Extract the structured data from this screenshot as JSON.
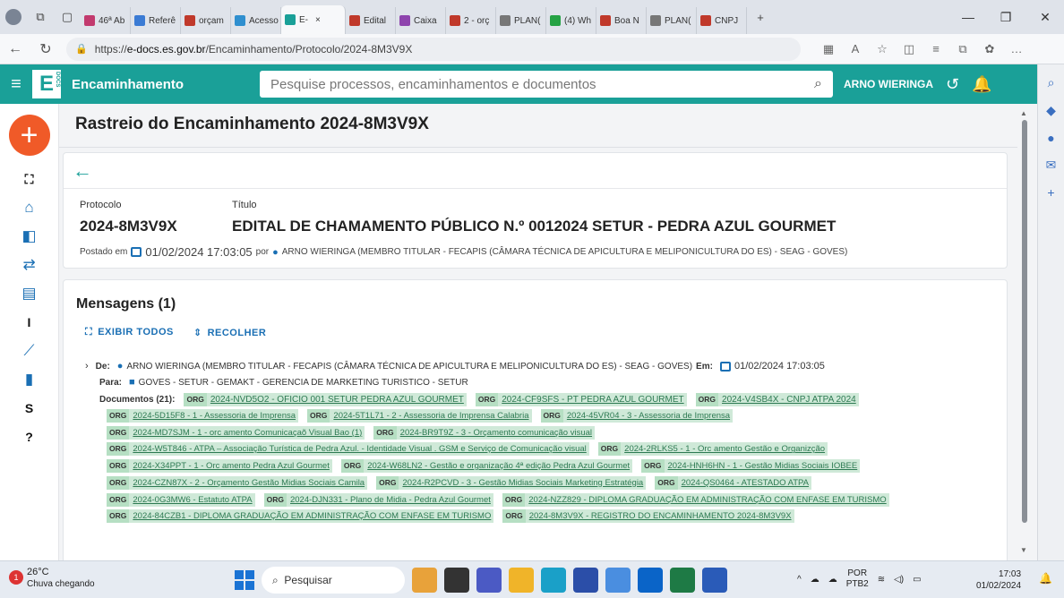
{
  "browser": {
    "tabs": [
      {
        "label": "46ª Ab",
        "color": "#c23a6e"
      },
      {
        "label": "Referê",
        "color": "#3b7bd4"
      },
      {
        "label": "orçam",
        "color": "#c0392b"
      },
      {
        "label": "Acesso",
        "color": "#2f8fcf"
      },
      {
        "label": "E-",
        "color": "#1aa098",
        "active": true
      },
      {
        "label": "Edital",
        "color": "#c0392b"
      },
      {
        "label": "Caixa",
        "color": "#8e44ad"
      },
      {
        "label": "2 - orç",
        "color": "#c0392b"
      },
      {
        "label": "PLAN(",
        "color": "#777777"
      },
      {
        "label": "(4) Wh",
        "color": "#25a244"
      },
      {
        "label": "Boa N",
        "color": "#c0392b"
      },
      {
        "label": "PLAN(",
        "color": "#777777"
      },
      {
        "label": "CNPJ",
        "color": "#c0392b"
      }
    ],
    "tab_close": "×",
    "new_tab": "+",
    "url_prefix": "https://",
    "url_host": "e-docs.es.gov.br",
    "url_path": "/Encaminhamento/Protocolo/2024-8M3V9X"
  },
  "header": {
    "app_title": "Encaminhamento",
    "logo_letter": "E",
    "logo_sub": "DOCS",
    "search_placeholder": "Pesquise processos, encaminhamentos e documentos",
    "user_name": "ARNO WIERINGA"
  },
  "page": {
    "title": "Rastreio do Encaminhamento 2024-8M3V9X",
    "protocolo_label": "Protocolo",
    "protocolo": "2024-8M3V9X",
    "titulo_label": "Título",
    "titulo": "EDITAL DE CHAMAMENTO PÚBLICO N.º 0012024 SETUR - PEDRA AZUL GOURMET",
    "posted_prefix": "Postado em",
    "posted_date": "01/02/2024 17:03:05",
    "posted_by_prefix": "por",
    "posted_by": "ARNO WIERINGA (MEMBRO TITULAR - FECAPIS (CÂMARA TÉCNICA DE APICULTURA E MELIPONICULTURA DO ES) - SEAG - GOVES)"
  },
  "messages": {
    "title": "Mensagens (1)",
    "show_all": "EXIBIR TODOS",
    "collapse": "RECOLHER",
    "de_label": "De:",
    "de_value": "ARNO WIERINGA (MEMBRO TITULAR - FECAPIS (CÂMARA TÉCNICA DE APICULTURA E MELIPONICULTURA DO ES) - SEAG - GOVES)",
    "em_label": "Em:",
    "em_value": "01/02/2024 17:03:05",
    "para_label": "Para:",
    "para_value": "GOVES - SETUR - GEMAKT - GERENCIA DE MARKETING TURISTICO - SETUR",
    "docs_label": "Documentos (21):",
    "org_tag": "ORG",
    "documents": [
      [
        "2024-NVD5O2 - OFICIO 001 SETUR PEDRA AZUL GOURMET",
        "2024-CF9SFS - PT PEDRA AZUL GOURMET",
        "2024-V4SB4X - CNPJ ATPA 2024"
      ],
      [
        "2024-5D15F8 - 1 - Assessoria de Imprensa",
        "2024-5T1L71 - 2 - Assessoria de Imprensa Calabria",
        "2024-45VR04 - 3 - Assessoria de Imprensa"
      ],
      [
        "2024-MD7SJM - 1 - orc amento Comunicaçaõ Visual Bao (1)",
        "2024-BR9T9Z - 3 - Orçamento comunicação visual"
      ],
      [
        "2024-W5T846 - ATPA – Associação Turística de Pedra Azul. - Identidade Visual . GSM e Serviço de Comunicação visual",
        "2024-2RLKS5 - 1 - Orc amento Gestão e Organizção"
      ],
      [
        "2024-X34PPT - 1 - Orc amento Pedra Azul Gourmet",
        "2024-W68LN2 - Gestão e organização 4ª edição Pedra Azul Gourmet",
        "2024-HNH6HN - 1 - Gestão Midias Sociais IOBEE"
      ],
      [
        "2024-CZN87X - 2 - Orçamento Gestão Midias Sociais Camila",
        "2024-R2PCVD - 3 - Gestão Midias Sociais Marketing Estratégia",
        "2024-QS0464 - ATESTADO ATPA"
      ],
      [
        "2024-0G3MW6 - Estatuto ATPA",
        "2024-DJN331 - Plano de Midia - Pedra Azul Gourmet",
        "2024-NZZ829 - DIPLOMA GRADUAÇÃO EM ADMINISTRAÇÃO COM ENFASE EM TURISMO"
      ],
      [
        "2024-84CZB1 - DIPLOMA GRADUAÇÃO EM ADMINISTRAÇÃO COM ENFASE EM TURISMO",
        "2024-8M3V9X - REGISTRO DO ENCAMINHAMENTO 2024-8M3V9X"
      ]
    ]
  },
  "rail": {
    "letter_i": "I",
    "letter_s": "S"
  },
  "taskbar": {
    "weather_badge": "1",
    "temp": "26°C",
    "weather_desc": "Chuva chegando",
    "search_label": "Pesquisar",
    "lang1": "POR",
    "lang2": "PTB2",
    "time": "17:03",
    "date": "01/02/2024"
  },
  "colors": {
    "brand": "#1aa098",
    "fab": "#f05a28",
    "link_green": "#2d7a52"
  }
}
